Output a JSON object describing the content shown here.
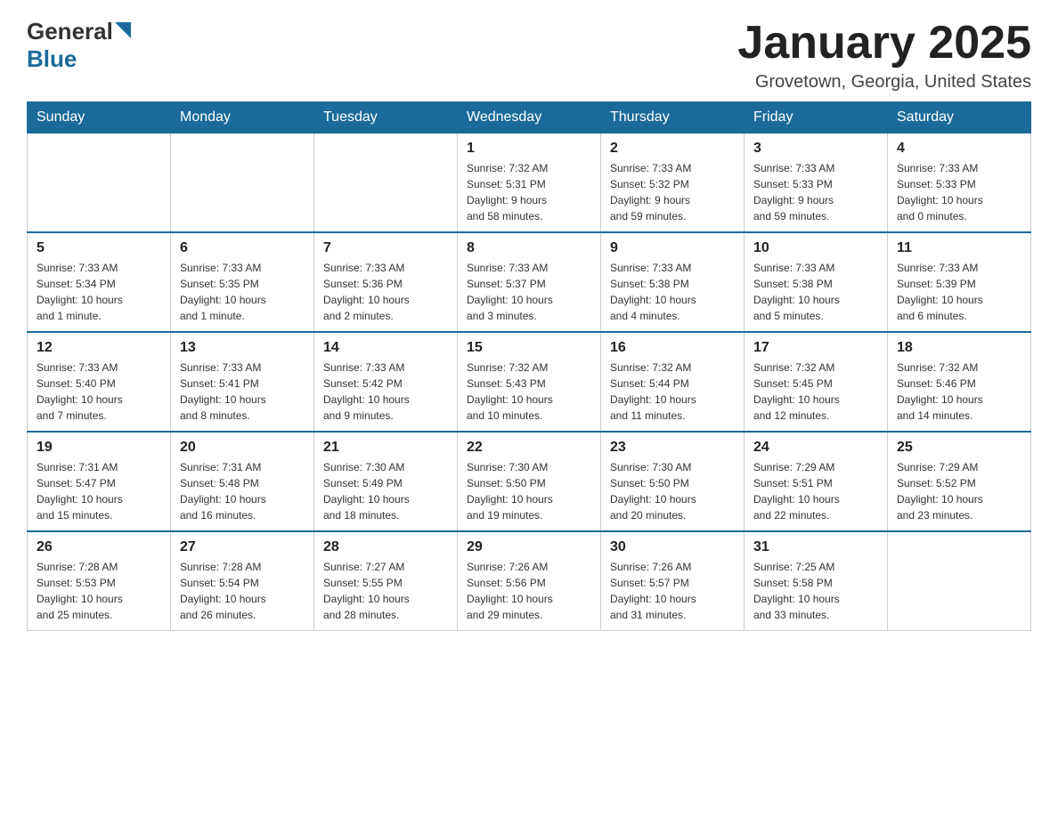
{
  "header": {
    "logo_general": "General",
    "logo_blue": "Blue",
    "title": "January 2025",
    "location": "Grovetown, Georgia, United States"
  },
  "calendar": {
    "days_of_week": [
      "Sunday",
      "Monday",
      "Tuesday",
      "Wednesday",
      "Thursday",
      "Friday",
      "Saturday"
    ],
    "weeks": [
      [
        {
          "day": "",
          "info": ""
        },
        {
          "day": "",
          "info": ""
        },
        {
          "day": "",
          "info": ""
        },
        {
          "day": "1",
          "info": "Sunrise: 7:32 AM\nSunset: 5:31 PM\nDaylight: 9 hours\nand 58 minutes."
        },
        {
          "day": "2",
          "info": "Sunrise: 7:33 AM\nSunset: 5:32 PM\nDaylight: 9 hours\nand 59 minutes."
        },
        {
          "day": "3",
          "info": "Sunrise: 7:33 AM\nSunset: 5:33 PM\nDaylight: 9 hours\nand 59 minutes."
        },
        {
          "day": "4",
          "info": "Sunrise: 7:33 AM\nSunset: 5:33 PM\nDaylight: 10 hours\nand 0 minutes."
        }
      ],
      [
        {
          "day": "5",
          "info": "Sunrise: 7:33 AM\nSunset: 5:34 PM\nDaylight: 10 hours\nand 1 minute."
        },
        {
          "day": "6",
          "info": "Sunrise: 7:33 AM\nSunset: 5:35 PM\nDaylight: 10 hours\nand 1 minute."
        },
        {
          "day": "7",
          "info": "Sunrise: 7:33 AM\nSunset: 5:36 PM\nDaylight: 10 hours\nand 2 minutes."
        },
        {
          "day": "8",
          "info": "Sunrise: 7:33 AM\nSunset: 5:37 PM\nDaylight: 10 hours\nand 3 minutes."
        },
        {
          "day": "9",
          "info": "Sunrise: 7:33 AM\nSunset: 5:38 PM\nDaylight: 10 hours\nand 4 minutes."
        },
        {
          "day": "10",
          "info": "Sunrise: 7:33 AM\nSunset: 5:38 PM\nDaylight: 10 hours\nand 5 minutes."
        },
        {
          "day": "11",
          "info": "Sunrise: 7:33 AM\nSunset: 5:39 PM\nDaylight: 10 hours\nand 6 minutes."
        }
      ],
      [
        {
          "day": "12",
          "info": "Sunrise: 7:33 AM\nSunset: 5:40 PM\nDaylight: 10 hours\nand 7 minutes."
        },
        {
          "day": "13",
          "info": "Sunrise: 7:33 AM\nSunset: 5:41 PM\nDaylight: 10 hours\nand 8 minutes."
        },
        {
          "day": "14",
          "info": "Sunrise: 7:33 AM\nSunset: 5:42 PM\nDaylight: 10 hours\nand 9 minutes."
        },
        {
          "day": "15",
          "info": "Sunrise: 7:32 AM\nSunset: 5:43 PM\nDaylight: 10 hours\nand 10 minutes."
        },
        {
          "day": "16",
          "info": "Sunrise: 7:32 AM\nSunset: 5:44 PM\nDaylight: 10 hours\nand 11 minutes."
        },
        {
          "day": "17",
          "info": "Sunrise: 7:32 AM\nSunset: 5:45 PM\nDaylight: 10 hours\nand 12 minutes."
        },
        {
          "day": "18",
          "info": "Sunrise: 7:32 AM\nSunset: 5:46 PM\nDaylight: 10 hours\nand 14 minutes."
        }
      ],
      [
        {
          "day": "19",
          "info": "Sunrise: 7:31 AM\nSunset: 5:47 PM\nDaylight: 10 hours\nand 15 minutes."
        },
        {
          "day": "20",
          "info": "Sunrise: 7:31 AM\nSunset: 5:48 PM\nDaylight: 10 hours\nand 16 minutes."
        },
        {
          "day": "21",
          "info": "Sunrise: 7:30 AM\nSunset: 5:49 PM\nDaylight: 10 hours\nand 18 minutes."
        },
        {
          "day": "22",
          "info": "Sunrise: 7:30 AM\nSunset: 5:50 PM\nDaylight: 10 hours\nand 19 minutes."
        },
        {
          "day": "23",
          "info": "Sunrise: 7:30 AM\nSunset: 5:50 PM\nDaylight: 10 hours\nand 20 minutes."
        },
        {
          "day": "24",
          "info": "Sunrise: 7:29 AM\nSunset: 5:51 PM\nDaylight: 10 hours\nand 22 minutes."
        },
        {
          "day": "25",
          "info": "Sunrise: 7:29 AM\nSunset: 5:52 PM\nDaylight: 10 hours\nand 23 minutes."
        }
      ],
      [
        {
          "day": "26",
          "info": "Sunrise: 7:28 AM\nSunset: 5:53 PM\nDaylight: 10 hours\nand 25 minutes."
        },
        {
          "day": "27",
          "info": "Sunrise: 7:28 AM\nSunset: 5:54 PM\nDaylight: 10 hours\nand 26 minutes."
        },
        {
          "day": "28",
          "info": "Sunrise: 7:27 AM\nSunset: 5:55 PM\nDaylight: 10 hours\nand 28 minutes."
        },
        {
          "day": "29",
          "info": "Sunrise: 7:26 AM\nSunset: 5:56 PM\nDaylight: 10 hours\nand 29 minutes."
        },
        {
          "day": "30",
          "info": "Sunrise: 7:26 AM\nSunset: 5:57 PM\nDaylight: 10 hours\nand 31 minutes."
        },
        {
          "day": "31",
          "info": "Sunrise: 7:25 AM\nSunset: 5:58 PM\nDaylight: 10 hours\nand 33 minutes."
        },
        {
          "day": "",
          "info": ""
        }
      ]
    ]
  }
}
